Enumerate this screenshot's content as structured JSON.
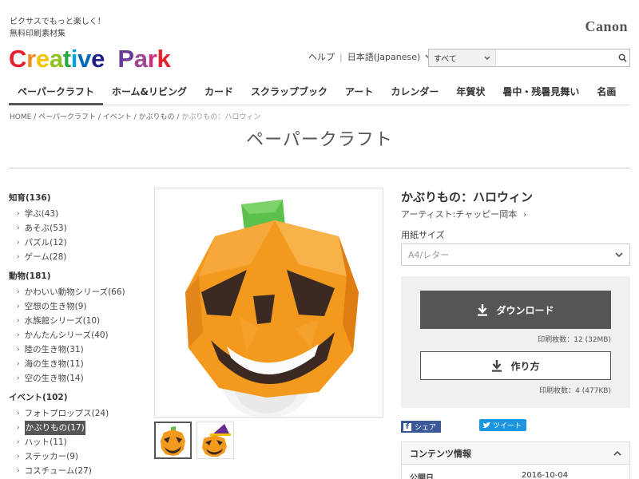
{
  "header": {
    "tagline_1": "ピクサスでもっと楽しく！",
    "tagline_2": "無料印刷素材集",
    "logo_letters": [
      "C",
      "r",
      "e",
      "a",
      "t",
      "i",
      "v",
      "e",
      " ",
      "P",
      "a",
      "r",
      "k"
    ],
    "logo_colors": [
      "#e6212d",
      "#f08d1e",
      "#f5c200",
      "#8dc21f",
      "#28a744",
      "#00a0e0",
      "#0068b7",
      "#1d2088",
      "",
      "#6a3a97",
      "#a0458f",
      "#d12b7d",
      "#e6212d"
    ],
    "brand": "Canon",
    "help": "ヘルプ",
    "language": "日本語(Japanese)",
    "search_scope": "すべて",
    "search_placeholder": ""
  },
  "main_nav": [
    {
      "label": "ペーパークラフト",
      "active": true
    },
    {
      "label": "ホーム&リビング"
    },
    {
      "label": "カード"
    },
    {
      "label": "スクラップブック"
    },
    {
      "label": "アート"
    },
    {
      "label": "カレンダー"
    },
    {
      "label": "年賀状"
    },
    {
      "label": "暑中・残暑見舞い"
    },
    {
      "label": "名画"
    }
  ],
  "breadcrumb": {
    "links": [
      "HOME",
      "ペーパークラフト",
      "イベント",
      "かぶりもの"
    ],
    "current": "かぶりもの：ハロウィン"
  },
  "page_title": "ペーパークラフト",
  "sidebar": [
    {
      "title": "知育(136)",
      "items": [
        "学ぶ(43)",
        "あそぶ(53)",
        "パズル(12)",
        "ゲーム(28)"
      ]
    },
    {
      "title": "動物(181)",
      "items": [
        "かわいい動物シリーズ(66)",
        "空想の生き物(9)",
        "水族館シリーズ(10)",
        "かんたんシリーズ(40)",
        "陸の生き物(31)",
        "海の生き物(11)",
        "空の生き物(14)"
      ]
    },
    {
      "title": "イベント(102)",
      "items": [
        "フォトプロップス(24)",
        "かぶりもの(17)",
        "ハット(11)",
        "ステッカー(9)",
        "コスチューム(27)"
      ],
      "selected": 1
    }
  ],
  "product": {
    "title": "かぶりもの：ハロウィン",
    "artist": "アーティスト:チャッピー岡本",
    "paper_label": "用紙サイズ",
    "paper_value": "A4/レター",
    "download_label": "ダウンロード",
    "download_count": "印刷枚数：12 (32MB)",
    "howto_label": "作り方",
    "howto_count": "印刷枚数：4 (477KB)",
    "share_label": "シェア",
    "tweet_label": "ツイート",
    "info_title": "コンテンツ情報",
    "info_key": "公開日",
    "info_value": "2016-10-04"
  },
  "icons": [
    "search-icon",
    "chevron-down-icon",
    "chevron-right-icon",
    "download-icon",
    "chevron-up-icon",
    "facebook-icon",
    "twitter-icon"
  ]
}
